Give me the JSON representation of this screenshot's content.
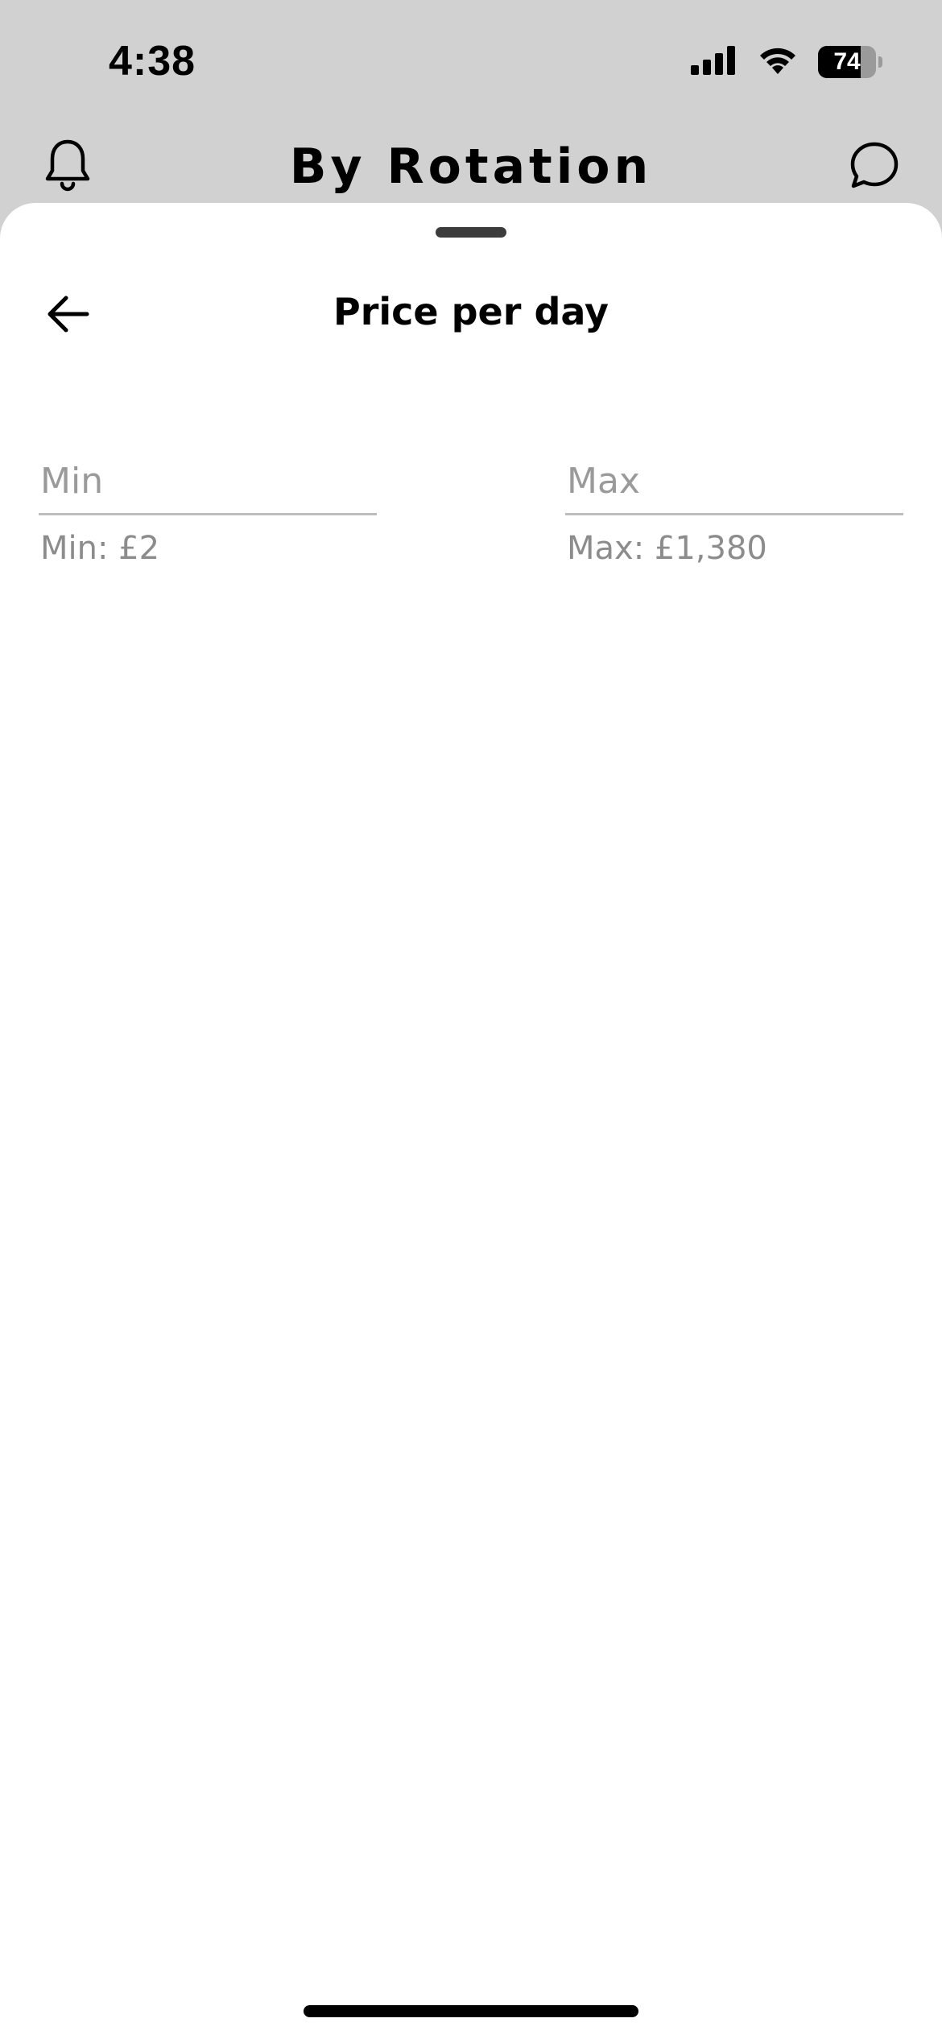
{
  "status_bar": {
    "time": "4:38",
    "battery_percent": "74",
    "battery_level": 0.74,
    "icons": [
      "signal-icon",
      "wifi-icon",
      "battery-icon"
    ]
  },
  "header": {
    "title": "By Rotation",
    "left_icon": "bell-icon",
    "right_icon": "chat-bubble-icon"
  },
  "sheet": {
    "title": "Price per day",
    "back_icon": "arrow-left-icon",
    "min_field": {
      "placeholder": "Min",
      "value": "",
      "hint": "Min: £2"
    },
    "max_field": {
      "placeholder": "Max",
      "value": "",
      "hint": "Max: £1,380"
    }
  },
  "colors": {
    "background_dim": "#d1d1d1",
    "sheet": "#ffffff",
    "text_primary": "#000000",
    "placeholder": "#9a9a9a",
    "hint": "#8c8c8c",
    "underline": "#bdbdbd"
  }
}
